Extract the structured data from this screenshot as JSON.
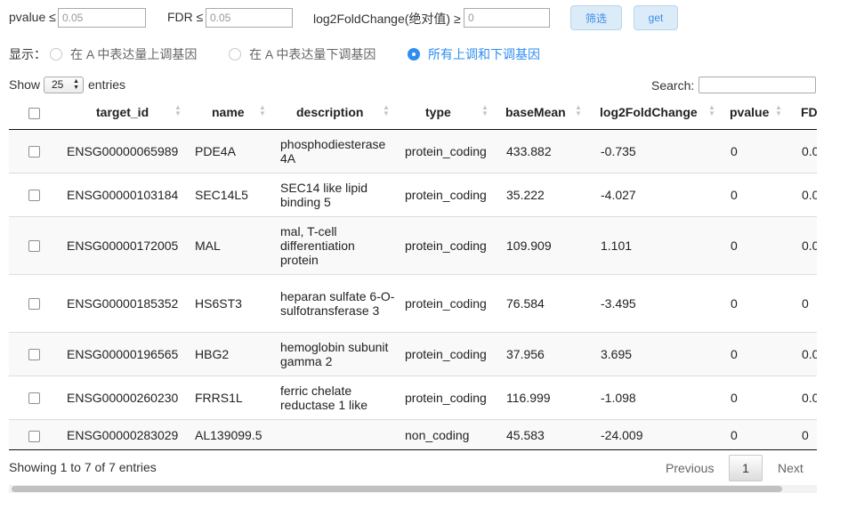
{
  "filters": {
    "pvalue_label": "pvalue ≤",
    "pvalue_placeholder": "0.05",
    "fdr_label": "FDR ≤",
    "fdr_placeholder": "0.05",
    "log2fc_label": "log2FoldChange(绝对值) ≥",
    "log2fc_placeholder": "0",
    "filter_button": "筛选",
    "get_button": "get"
  },
  "display": {
    "label": "显示：",
    "options": [
      {
        "label": "在 A 中表达量上调基因",
        "selected": false
      },
      {
        "label": "在 A 中表达量下调基因",
        "selected": false
      },
      {
        "label": "所有上调和下调基因",
        "selected": true
      }
    ]
  },
  "length": {
    "show": "Show",
    "value": "25",
    "entries": "entries"
  },
  "search": {
    "label": "Search:",
    "value": ""
  },
  "table": {
    "columns": [
      "target_id",
      "name",
      "description",
      "type",
      "baseMean",
      "log2FoldChange",
      "pvalue",
      "FDR"
    ],
    "rows": [
      [
        "ENSG00000065989",
        "PDE4A",
        "phosphodiesterase 4A",
        "protein_coding",
        "433.882",
        "-0.735",
        "0",
        "0.0"
      ],
      [
        "ENSG00000103184",
        "SEC14L5",
        "SEC14 like lipid binding 5",
        "protein_coding",
        "35.222",
        "-4.027",
        "0",
        "0.0"
      ],
      [
        "ENSG00000172005",
        "MAL",
        "mal, T-cell differentiation protein",
        "protein_coding",
        "109.909",
        "1.101",
        "0",
        "0.0"
      ],
      [
        "ENSG00000185352",
        "HS6ST3",
        "heparan sulfate 6-O-sulfotransferase 3",
        "protein_coding",
        "76.584",
        "-3.495",
        "0",
        "0"
      ],
      [
        "ENSG00000196565",
        "HBG2",
        "hemoglobin subunit gamma 2",
        "protein_coding",
        "37.956",
        "3.695",
        "0",
        "0.0"
      ],
      [
        "ENSG00000260230",
        "FRRS1L",
        "ferric chelate reductase 1 like",
        "protein_coding",
        "116.999",
        "-1.098",
        "0",
        "0.0"
      ],
      [
        "ENSG00000283029",
        "AL139099.5",
        "",
        "non_coding",
        "45.583",
        "-24.009",
        "0",
        "0"
      ]
    ]
  },
  "footer": {
    "info": "Showing 1 to 7 of 7 entries",
    "previous": "Previous",
    "page": "1",
    "next": "Next"
  },
  "colors": {
    "accent": "#2e8ef0",
    "button_bg": "#dcebf8",
    "row_stripe": "#f9f9f9"
  }
}
